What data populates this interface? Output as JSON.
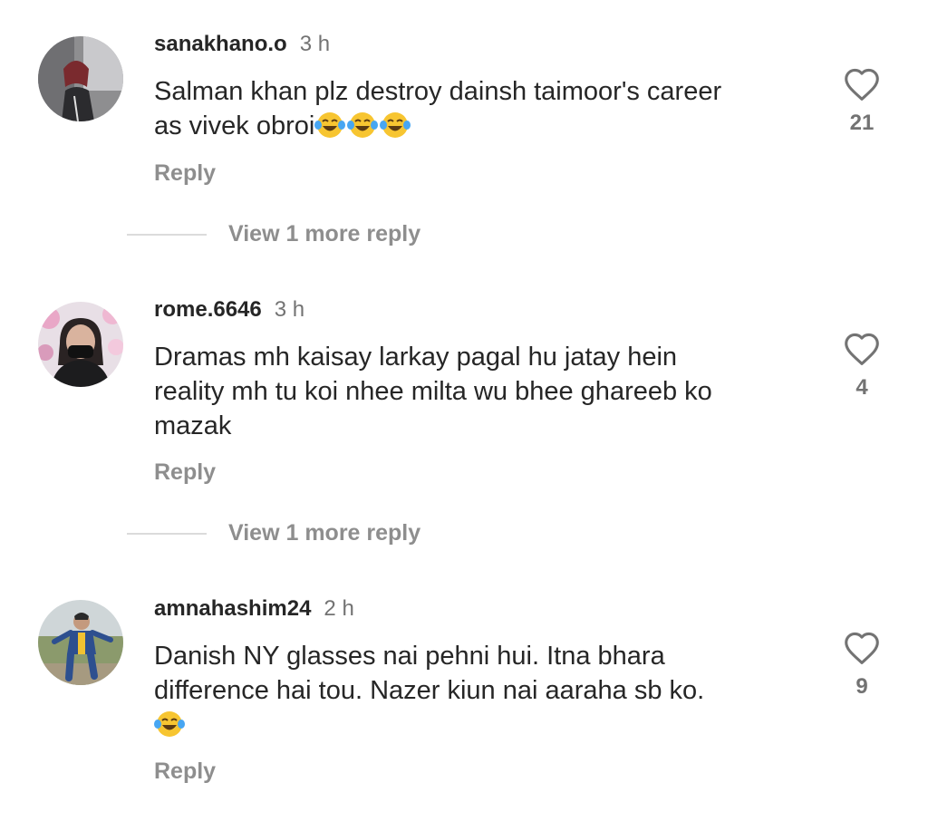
{
  "comments": [
    {
      "username": "sanakhano.o",
      "time": "3 h",
      "text_line1": "Salman khan plz destroy dainsh taimoor's career",
      "text_line2": "as vivek obroi",
      "emoji_count": 3,
      "likes": "21",
      "reply_label": "Reply",
      "view_more": "View 1 more reply"
    },
    {
      "username": "rome.6646",
      "time": "3 h",
      "text_line1": "Dramas mh kaisay larkay pagal hu jatay hein",
      "text_line2": "reality mh tu koi nhee milta wu bhee ghareeb ko",
      "text_line3": "mazak",
      "likes": "4",
      "reply_label": "Reply",
      "view_more": "View 1 more reply"
    },
    {
      "username": "amnahashim24",
      "time": "2 h",
      "text_line1": "Danish NY glasses nai pehni hui. Itna bhara",
      "text_line2": "difference hai tou. Nazer kiun nai aaraha sb ko.",
      "emoji_count": 1,
      "likes": "9",
      "reply_label": "Reply"
    }
  ],
  "icons": {
    "like": "heart-outline-icon",
    "emoji": "face-with-tears-of-joy-emoji"
  },
  "colors": {
    "text": "#262626",
    "secondary": "#737373",
    "reply": "#8e8e8e"
  }
}
